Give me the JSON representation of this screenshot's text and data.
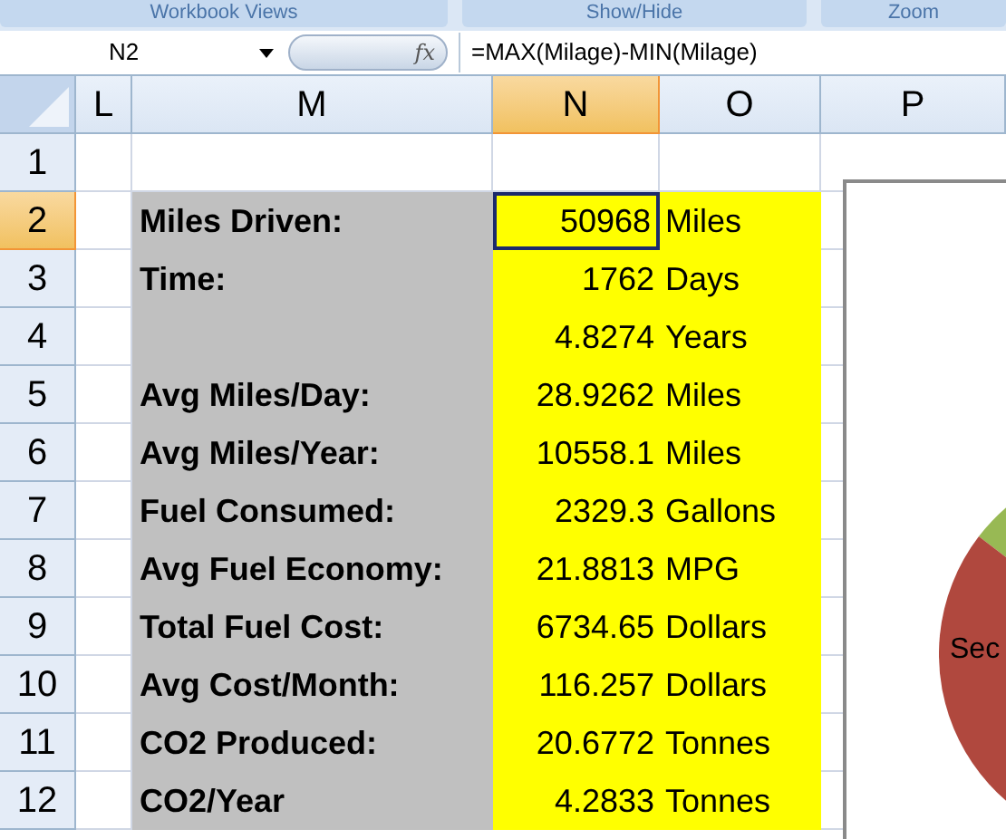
{
  "ribbon_groups": [
    "Workbook Views",
    "Show/Hide",
    "Zoom"
  ],
  "formula_bar": {
    "name_box": "N2",
    "function_label": "fx",
    "formula": "=MAX(Milage)-MIN(Milage)"
  },
  "columns": [
    {
      "label": "L",
      "selected": false
    },
    {
      "label": "M",
      "selected": false
    },
    {
      "label": "N",
      "selected": true
    },
    {
      "label": "O",
      "selected": false
    },
    {
      "label": "P",
      "selected": false
    }
  ],
  "rows": [
    {
      "number": "1",
      "selected": false,
      "shaded": false,
      "active": false
    },
    {
      "number": "2",
      "selected": true,
      "shaded": true,
      "label": "Miles Driven:",
      "value": "50968",
      "unit": "Miles",
      "active": true
    },
    {
      "number": "3",
      "selected": false,
      "shaded": true,
      "label": "Time:",
      "value": "1762",
      "unit": "Days",
      "active": false
    },
    {
      "number": "4",
      "selected": false,
      "shaded": true,
      "value": "4.8274",
      "unit": "Years",
      "active": false
    },
    {
      "number": "5",
      "selected": false,
      "shaded": true,
      "label": "Avg Miles/Day:",
      "value": "28.9262",
      "unit": "Miles",
      "active": false
    },
    {
      "number": "6",
      "selected": false,
      "shaded": true,
      "label": "Avg Miles/Year:",
      "value": "10558.1",
      "unit": "Miles",
      "active": false
    },
    {
      "number": "7",
      "selected": false,
      "shaded": true,
      "label": "Fuel Consumed:",
      "value": "2329.3",
      "unit": "Gallons",
      "active": false
    },
    {
      "number": "8",
      "selected": false,
      "shaded": true,
      "label": "Avg Fuel Economy:",
      "value": "21.8813",
      "unit": "MPG",
      "active": false
    },
    {
      "number": "9",
      "selected": false,
      "shaded": true,
      "label": "Total Fuel Cost:",
      "value": "6734.65",
      "unit": "Dollars",
      "active": false
    },
    {
      "number": "10",
      "selected": false,
      "shaded": true,
      "label": "Avg Cost/Month:",
      "value": "116.257",
      "unit": "Dollars",
      "active": false
    },
    {
      "number": "11",
      "selected": false,
      "shaded": true,
      "label": "CO2 Produced:",
      "value": "20.6772",
      "unit": "Tonnes",
      "active": false
    },
    {
      "number": "12",
      "selected": false,
      "shaded": true,
      "label": "CO2/Year",
      "value": "4.2833",
      "unit": "Tonnes",
      "active": false
    }
  ],
  "chart": {
    "slice_label": "Sec"
  }
}
